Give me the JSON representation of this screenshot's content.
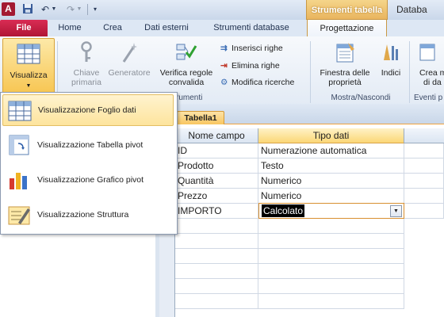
{
  "titlebar": {
    "app_icon": "A",
    "context_group": "Strumenti tabella",
    "window_title": "Databa"
  },
  "tabs": {
    "file": "File",
    "home": "Home",
    "create": "Crea",
    "external": "Dati esterni",
    "dbtools": "Strumenti database",
    "design": "Progettazione"
  },
  "ribbon": {
    "views": {
      "visualizza": "Visualizza"
    },
    "tools": {
      "primary_key": [
        "Chiave",
        "primaria"
      ],
      "builder": "Generatore",
      "validate": [
        "Verifica regole",
        "convalida"
      ],
      "insert_rows": "Inserisci righe",
      "delete_rows": "Elimina righe",
      "modify_lookups": "Modifica ricerche",
      "group_label": "rumenti"
    },
    "showhide": {
      "properties": [
        "Finestra delle",
        "proprietà"
      ],
      "indexes": "Indici",
      "group_label": "Mostra/Nascondi"
    },
    "events": {
      "create": [
        "Crea m",
        "di da"
      ],
      "group_label": "Eventi p"
    }
  },
  "view_menu": {
    "items": [
      {
        "label": "Visualizzazione Foglio dati"
      },
      {
        "label": "Visualizzazione Tabella pivot"
      },
      {
        "label": "Visualizzazione Grafico pivot"
      },
      {
        "label": "Visualizzazione Struttura"
      }
    ]
  },
  "document": {
    "tab": "Tabella1",
    "headers": {
      "name": "Nome campo",
      "type": "Tipo dati"
    },
    "rows": [
      {
        "name": "ID",
        "type": "Numerazione automatica"
      },
      {
        "name": "Prodotto",
        "type": "Testo"
      },
      {
        "name": "Quantità",
        "type": "Numerico"
      },
      {
        "name": "Prezzo",
        "type": "Numerico"
      },
      {
        "name": "IMPORTO",
        "type": "Calcolato"
      }
    ]
  },
  "colors": {
    "file_tab": "#c41e3a",
    "context_tab": "#f0c36d",
    "selection_highlight": "#fde49d",
    "active_cell_border": "#d88f2f"
  }
}
